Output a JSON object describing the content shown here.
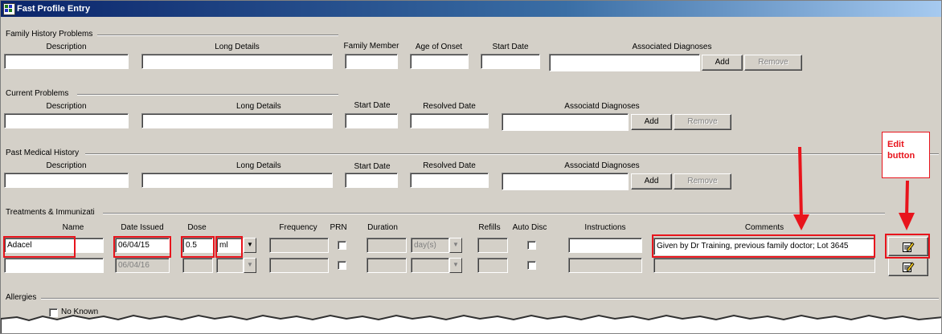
{
  "window": {
    "title": "Fast Profile Entry"
  },
  "family_history": {
    "section_label": "Family History Problems",
    "col_description": "Description",
    "col_long_details": "Long Details",
    "col_family_member": "Family Member",
    "col_age_of_onset": "Age of Onset",
    "col_start_date": "Start Date",
    "col_associated_diagnoses": "Associated Diagnoses",
    "add_label": "Add",
    "remove_label": "Remove"
  },
  "current_problems": {
    "section_label": "Current Problems",
    "col_description": "Description",
    "col_long_details": "Long Details",
    "col_start_date": "Start Date",
    "col_resolved_date": "Resolved Date",
    "col_associated_diagnoses": "Associatd Diagnoses",
    "add_label": "Add",
    "remove_label": "Remove"
  },
  "past_medical": {
    "section_label": "Past Medical History",
    "col_description": "Description",
    "col_long_details": "Long Details",
    "col_start_date": "Start Date",
    "col_resolved_date": "Resolved Date",
    "col_associated_diagnoses": "Associatd Diagnoses",
    "add_label": "Add",
    "remove_label": "Remove"
  },
  "treatments": {
    "section_label": "Treatments & Immunizati",
    "col_name": "Name",
    "col_date_issued": "Date Issued",
    "col_dose": "Dose",
    "col_frequency": "Frequency",
    "col_prn": "PRN",
    "col_duration": "Duration",
    "col_refills": "Refills",
    "col_auto_disc": "Auto Disc",
    "col_instructions": "Instructions",
    "col_comments": "Comments",
    "rows": [
      {
        "name": "Adacel",
        "date_issued": "06/04/15",
        "dose": "0.5",
        "unit": "ml",
        "duration_unit": "day(s)",
        "comments": "Given by Dr Training, previous family doctor; Lot 3645"
      },
      {
        "name": "",
        "date_issued": "06/04/16",
        "dose": "",
        "unit": "",
        "duration_unit": "",
        "comments": ""
      }
    ]
  },
  "allergies": {
    "section_label": "Allergies",
    "no_known_label": "No Known"
  },
  "annotation": {
    "callout_text": "Edit button",
    "color": "#e8141c"
  }
}
